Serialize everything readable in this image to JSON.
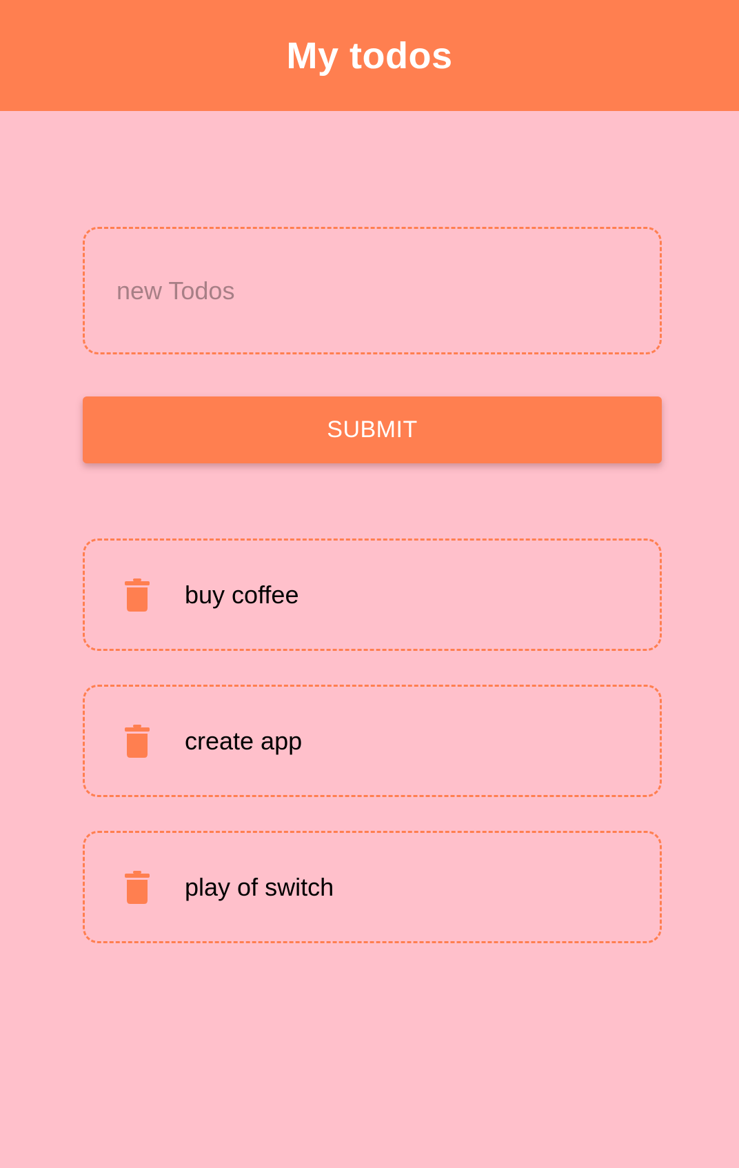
{
  "header": {
    "title": "My todos"
  },
  "form": {
    "input_placeholder": "new Todos",
    "input_value": "",
    "submit_label": "SUBMIT"
  },
  "todos": [
    {
      "text": "buy coffee",
      "icon": "trash-icon"
    },
    {
      "text": "create app",
      "icon": "trash-icon"
    },
    {
      "text": "play of switch",
      "icon": "trash-icon"
    }
  ],
  "colors": {
    "accent": "#ff7f50",
    "background": "#ffc0cb",
    "header_text": "#ffffff",
    "item_text": "#000000"
  }
}
